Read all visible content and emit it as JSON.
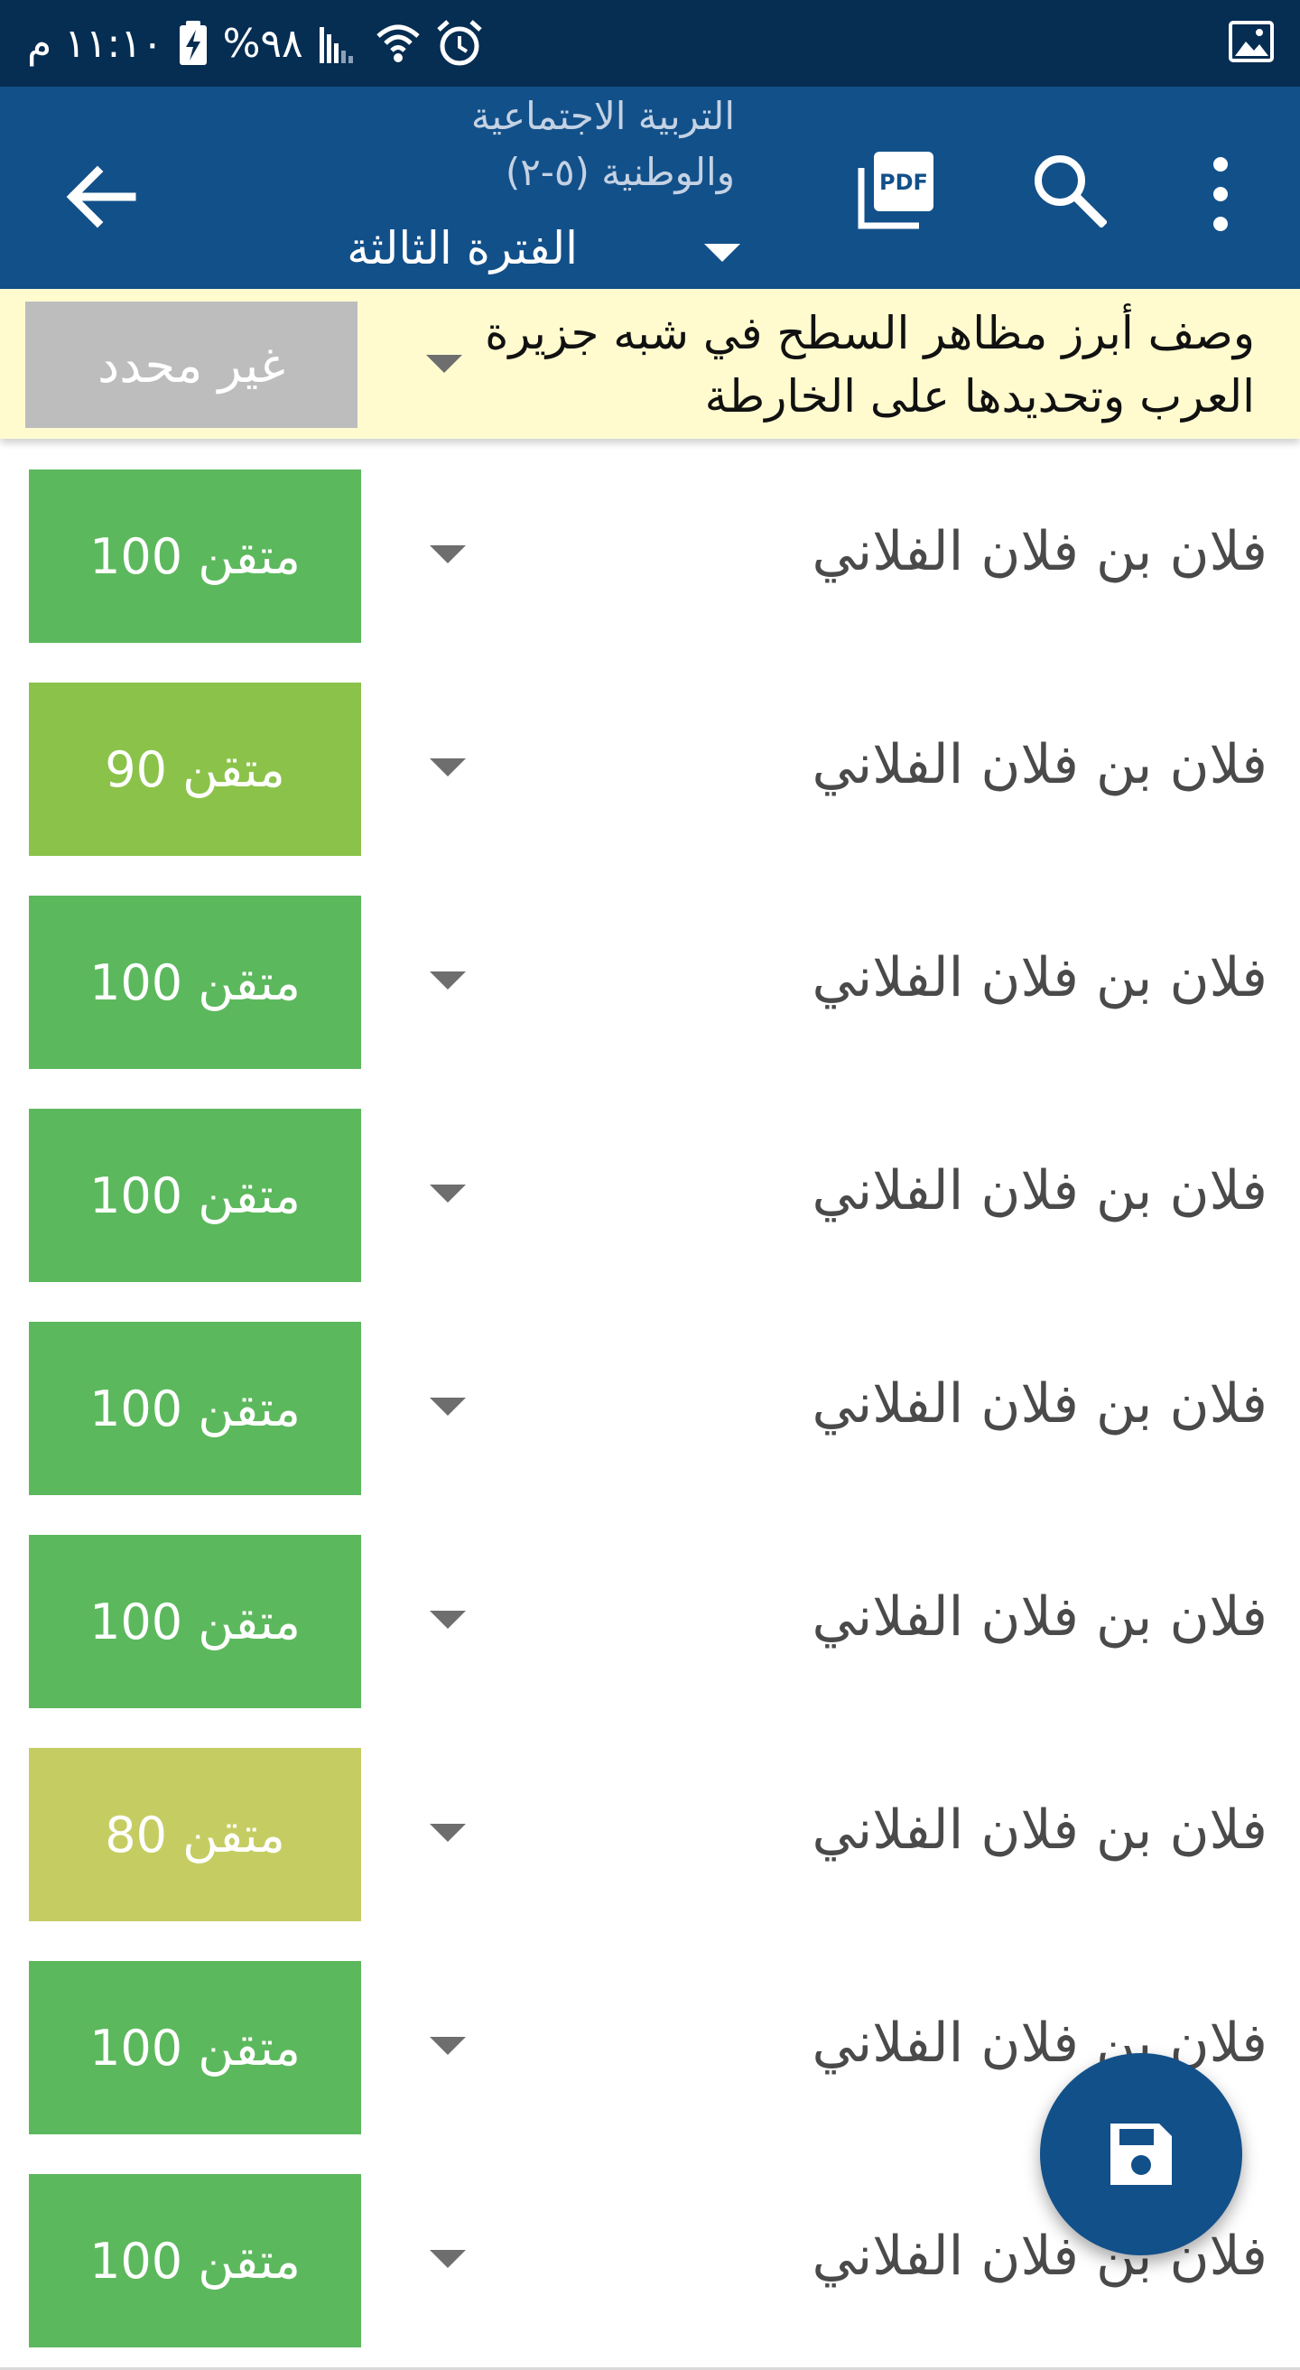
{
  "status_bar": {
    "time": "١١:١٠ م",
    "battery": "%٩٨"
  },
  "app_bar": {
    "title_line1": "التربية الاجتماعية",
    "title_line2": "والوطنية (٥-٢)",
    "period": "الفترة الثالثة"
  },
  "criterion": {
    "text": "وصف أبرز مظاهر السطح في شبه جزيرة العرب وتحديدها على الخارطة",
    "grade_label": "غير محدد"
  },
  "students": [
    {
      "name": "فلان بن فلان الفلاني",
      "grade": "متقن 100",
      "color": "#5cb85c"
    },
    {
      "name": "فلان بن فلان الفلاني",
      "grade": "متقن 90",
      "color": "#8bc34a"
    },
    {
      "name": "فلان بن فلان الفلاني",
      "grade": "متقن 100",
      "color": "#5cb85c"
    },
    {
      "name": "فلان بن فلان الفلاني",
      "grade": "متقن 100",
      "color": "#5cb85c"
    },
    {
      "name": "فلان بن فلان الفلاني",
      "grade": "متقن 100",
      "color": "#5cb85c"
    },
    {
      "name": "فلان بن فلان الفلاني",
      "grade": "متقن 100",
      "color": "#5cb85c"
    },
    {
      "name": "فلان بن فلان الفلاني",
      "grade": "متقن 80",
      "color": "#c5cd62"
    },
    {
      "name": "فلان بن فلان الفلاني",
      "grade": "متقن 100",
      "color": "#5cb85c"
    },
    {
      "name": "فلان بن فلان الفلاني",
      "grade": "متقن 100",
      "color": "#5cb85c"
    }
  ],
  "colors": {
    "status_bar": "#062d52",
    "app_bar": "#12508a",
    "banner": "#fffbcf",
    "undefined_grade": "#bdbdbd"
  },
  "icons": {
    "back": "arrow-back-icon",
    "pdf": "pdf-icon",
    "search": "search-icon",
    "more": "more-vertical-icon",
    "save": "save-icon"
  }
}
